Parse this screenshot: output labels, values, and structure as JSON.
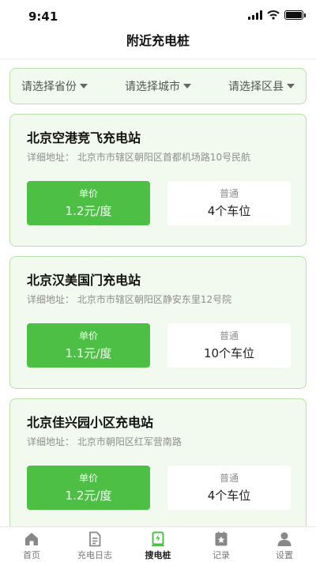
{
  "status_bar": {
    "time": "9:41"
  },
  "header": {
    "title": "附近充电桩"
  },
  "filters": {
    "province": "请选择省份",
    "city": "请选择城市",
    "district": "请选择区县"
  },
  "stations": [
    {
      "name": "北京空港竞飞充电站",
      "address": "详细地址：  北京市市辖区朝阳区首都机场路10号民航",
      "price_label": "单价",
      "price": "1.2元/度",
      "spot_type": "普通",
      "spots": "4个车位"
    },
    {
      "name": "北京汉美国门充电站",
      "address": "详细地址：  北京市市辖区朝阳区静安东里12号院",
      "price_label": "单价",
      "price": "1.1元/度",
      "spot_type": "普通",
      "spots": "10个车位"
    },
    {
      "name": "北京佳兴园小区充电站",
      "address": "详细地址：  北京市朝阳区红军营南路",
      "price_label": "单价",
      "price": "1.2元/度",
      "spot_type": "普通",
      "spots": "4个车位"
    }
  ],
  "tabbar": {
    "items": [
      {
        "label": "首页",
        "icon": "home-icon"
      },
      {
        "label": "充电日志",
        "icon": "document-icon"
      },
      {
        "label": "搜电桩",
        "icon": "charging-pile-icon"
      },
      {
        "label": "记录",
        "icon": "record-icon"
      },
      {
        "label": "设置",
        "icon": "user-icon"
      }
    ],
    "active_index": 2
  },
  "colors": {
    "accent": "#4cbf44",
    "card_bg": "#f2faef",
    "card_border": "#b9e0a8"
  }
}
